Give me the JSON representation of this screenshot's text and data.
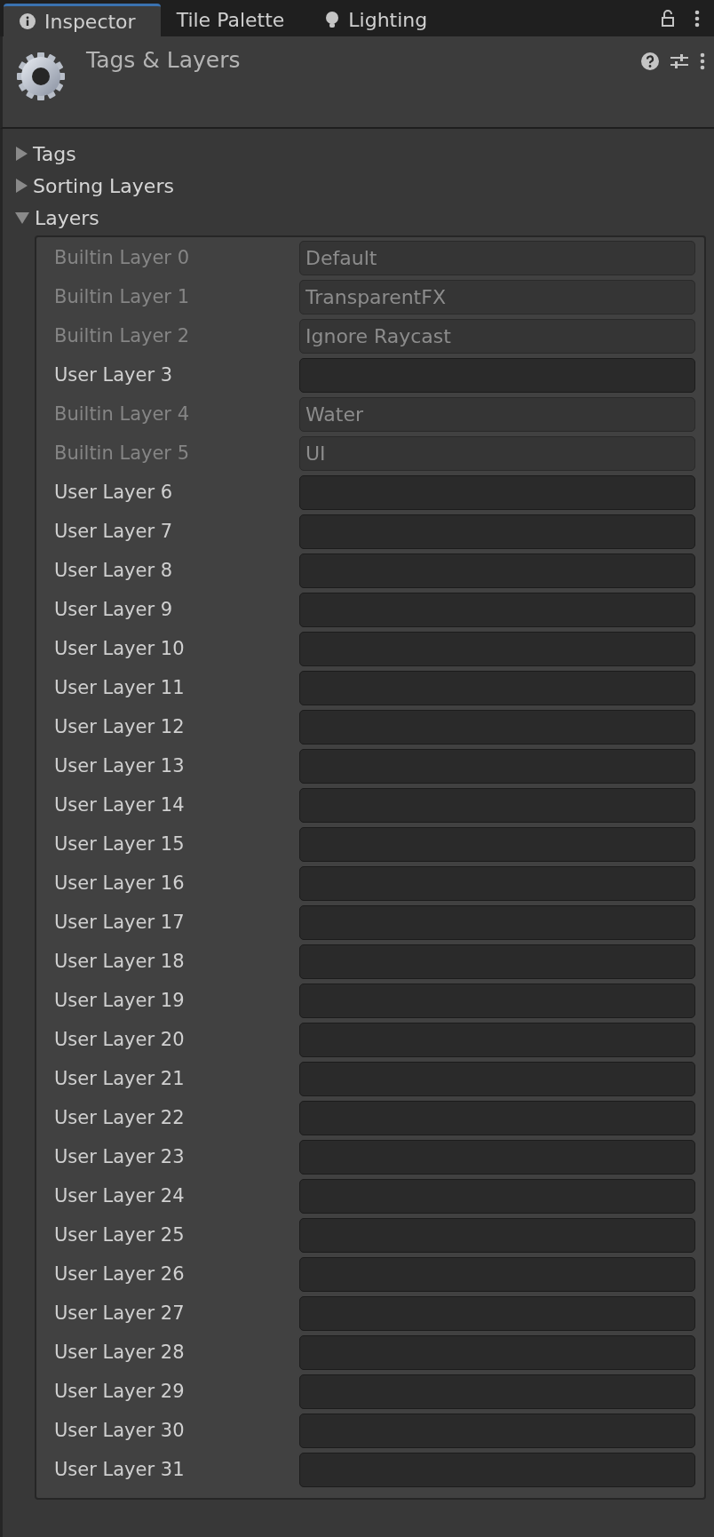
{
  "tabs": [
    {
      "label": "Inspector",
      "selected": true
    },
    {
      "label": "Tile Palette",
      "selected": false
    },
    {
      "label": "Lighting",
      "selected": false
    }
  ],
  "header": {
    "title": "Tags & Layers"
  },
  "foldouts": [
    {
      "label": "Tags",
      "expanded": false
    },
    {
      "label": "Sorting Layers",
      "expanded": false
    },
    {
      "label": "Layers",
      "expanded": true
    }
  ],
  "layers": [
    {
      "label": "Builtin Layer 0",
      "value": "Default",
      "disabled": true
    },
    {
      "label": "Builtin Layer 1",
      "value": "TransparentFX",
      "disabled": true
    },
    {
      "label": "Builtin Layer 2",
      "value": "Ignore Raycast",
      "disabled": true
    },
    {
      "label": "User Layer 3",
      "disabled": false
    },
    {
      "label": "Builtin Layer 4",
      "value": "Water",
      "disabled": true
    },
    {
      "label": "Builtin Layer 5",
      "value": "UI",
      "disabled": true
    },
    {
      "label": "User Layer 6",
      "disabled": false
    },
    {
      "label": "User Layer 7",
      "disabled": false
    },
    {
      "label": "User Layer 8",
      "disabled": false
    },
    {
      "label": "User Layer 9",
      "disabled": false
    },
    {
      "label": "User Layer 10",
      "disabled": false
    },
    {
      "label": "User Layer 11",
      "disabled": false
    },
    {
      "label": "User Layer 12",
      "disabled": false
    },
    {
      "label": "User Layer 13",
      "disabled": false
    },
    {
      "label": "User Layer 14",
      "disabled": false
    },
    {
      "label": "User Layer 15",
      "disabled": false
    },
    {
      "label": "User Layer 16",
      "disabled": false
    },
    {
      "label": "User Layer 17",
      "disabled": false
    },
    {
      "label": "User Layer 18",
      "disabled": false
    },
    {
      "label": "User Layer 19",
      "disabled": false
    },
    {
      "label": "User Layer 20",
      "disabled": false
    },
    {
      "label": "User Layer 21",
      "disabled": false
    },
    {
      "label": "User Layer 22",
      "disabled": false
    },
    {
      "label": "User Layer 23",
      "disabled": false
    },
    {
      "label": "User Layer 24",
      "disabled": false
    },
    {
      "label": "User Layer 25",
      "disabled": false
    },
    {
      "label": "User Layer 26",
      "disabled": false
    },
    {
      "label": "User Layer 27",
      "disabled": false
    },
    {
      "label": "User Layer 28",
      "disabled": false
    },
    {
      "label": "User Layer 29",
      "disabled": false
    },
    {
      "label": "User Layer 30",
      "disabled": false
    },
    {
      "label": "User Layer 31",
      "disabled": false
    }
  ]
}
